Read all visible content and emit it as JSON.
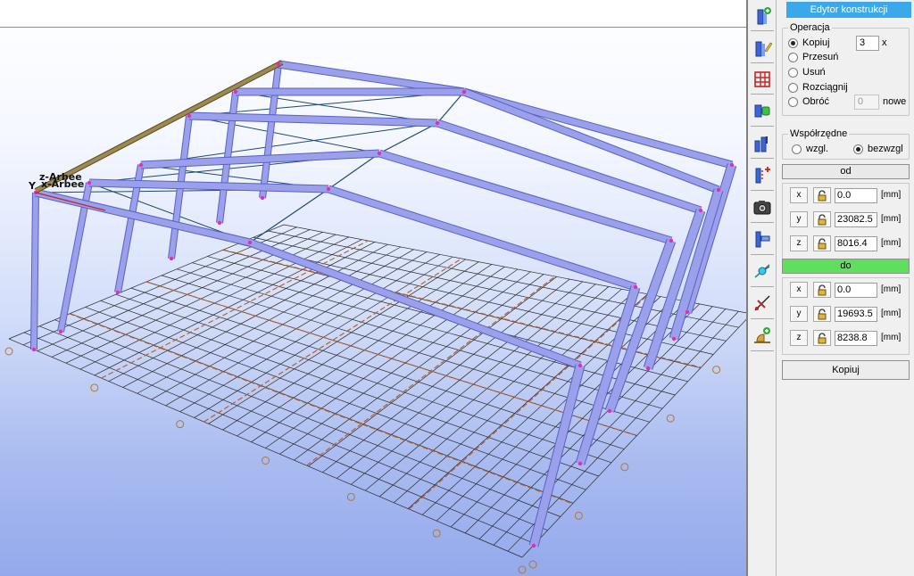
{
  "panel": {
    "title": "Edytor konstrukcji",
    "operation": {
      "label": "Operacja",
      "options": [
        "Kopiuj",
        "Przesuń",
        "Usuń",
        "Rozciągnij",
        "Obróć"
      ],
      "selected": "Kopiuj",
      "copy_count": "3",
      "copy_count_suffix": "x",
      "rotate_value": "0",
      "rotate_suffix": "nowe"
    },
    "coordinates": {
      "label": "Współrzędne",
      "options": [
        "wzgl.",
        "bezwzgl"
      ],
      "selected": "bezwzgl"
    },
    "from": {
      "label": "od",
      "x": "0.0",
      "y": "23082.5",
      "z": "8016.4"
    },
    "to": {
      "label": "do",
      "x": "0.0",
      "y": "19693.5",
      "z": "8238.8"
    },
    "axis_labels": [
      "x",
      "y",
      "z"
    ],
    "unit": "[mm]",
    "action_label": "Kopiuj"
  },
  "viewport": {
    "axis_labels": [
      "z-Arbee",
      "Y",
      "x-Arbee"
    ]
  },
  "toolbar": {
    "tools": [
      "add-column-icon",
      "edit-column-icon",
      "grid-icon",
      "connect-icon",
      "columns-icon",
      "insert-node-icon",
      "camera-icon",
      "align-icon",
      "link-node-icon",
      "cut-line-icon",
      "add-support-icon"
    ]
  },
  "colors": {
    "member": "#9aa0ea",
    "member_edge": "#5a61c7",
    "grid": "#2a2a2a",
    "axis": "#b4612a",
    "ridge_beam": "#9c8a52",
    "panel_title_bg": "#3aa9ec",
    "section_do_bg": "#5ee05e"
  }
}
